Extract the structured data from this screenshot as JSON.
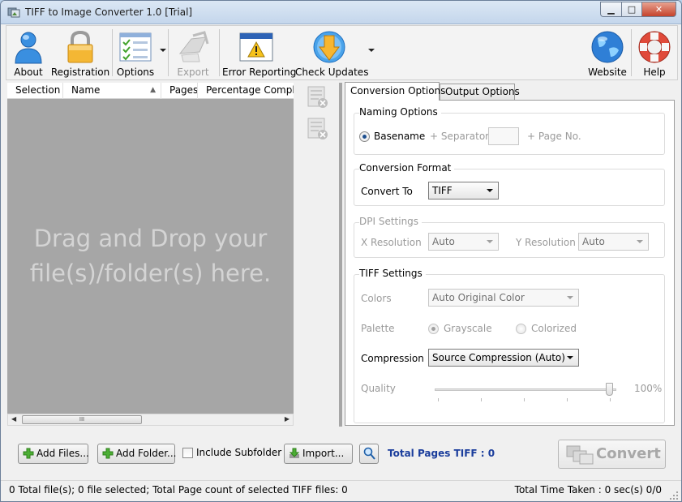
{
  "window": {
    "title": "TIFF to Image Converter 1.0 [Trial]",
    "min_glyph": "▁",
    "max_glyph": "□",
    "close_glyph": "✕"
  },
  "toolbar": {
    "about": "About",
    "registration": "Registration",
    "options": "Options",
    "export": "Export",
    "error_reporting": "Error Reporting",
    "check_updates": "Check Updates",
    "website": "Website",
    "help": "Help"
  },
  "file_list": {
    "columns": [
      "Selection",
      "Name",
      "Pages",
      "Percentage Complet"
    ],
    "drop_hint": "Drag and Drop your file(s)/folder(s) here.",
    "scroll_grip": "III"
  },
  "tabs": {
    "conversion": "Conversion Options",
    "output": "Output Options"
  },
  "naming": {
    "title": "Naming Options",
    "basename": "Basename",
    "separator": "+ Separator",
    "page_no": "+ Page No."
  },
  "format": {
    "title": "Conversion Format",
    "convert_to_label": "Convert To",
    "convert_to_value": "TIFF"
  },
  "dpi": {
    "title": "DPI Settings",
    "x_label": "X Resolution",
    "x_value": "Auto",
    "y_label": "Y Resolution",
    "y_value": "Auto"
  },
  "tiff": {
    "title": "TIFF Settings",
    "colors_label": "Colors",
    "colors_value": "Auto Original Color",
    "palette_label": "Palette",
    "grayscale": "Grayscale",
    "colorized": "Colorized",
    "compression_label": "Compression",
    "compression_value": "Source Compression (Auto)",
    "quality_label": "Quality",
    "quality_value": "100%",
    "quality_level": 1.0
  },
  "bottom": {
    "add_files": "Add Files...",
    "add_folder": "Add Folder...",
    "include_subfolder": "Include Subfolder",
    "import": "Import...",
    "total_pages": "Total Pages TIFF : 0",
    "convert": "Convert"
  },
  "status": {
    "left": "0 Total file(s); 0 file selected; Total Page count of selected TIFF files: 0",
    "right": "Total Time Taken : 0 sec(s)  0/0"
  },
  "colors": {
    "accent_blue": "#1a3d9c",
    "dropzone": "#a6a6a6"
  }
}
